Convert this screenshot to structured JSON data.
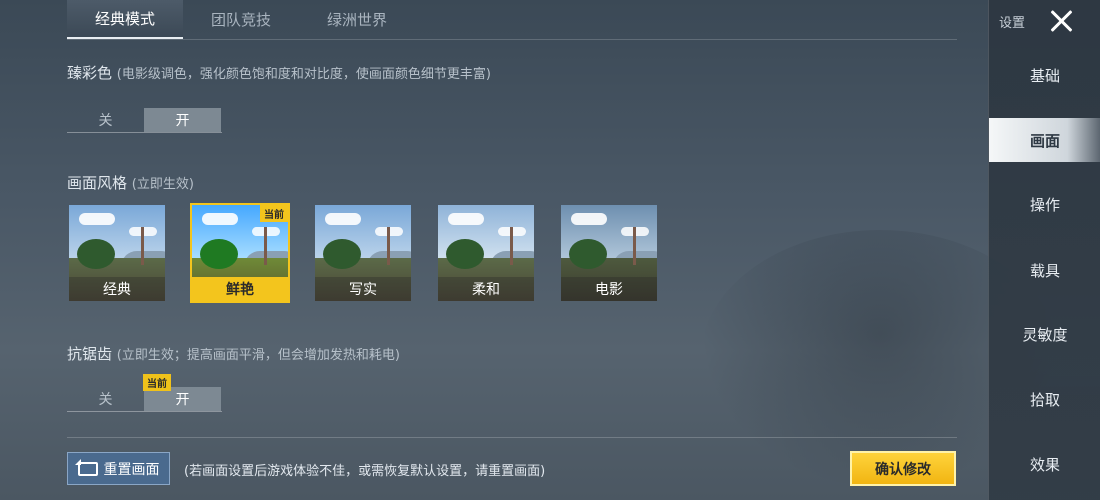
{
  "tabs": [
    "经典模式",
    "团队竞技",
    "绿洲世界"
  ],
  "color_section": {
    "title": "臻彩色",
    "note": "(电影级调色，强化颜色饱和度和对比度，使画面颜色细节更丰富)",
    "off": "关",
    "on": "开"
  },
  "style_section": {
    "title": "画面风格",
    "note": "(立即生效)",
    "current_badge": "当前",
    "options": [
      "经典",
      "鲜艳",
      "写实",
      "柔和",
      "电影"
    ]
  },
  "aa_section": {
    "title": "抗锯齿",
    "note": "(立即生效；提高画面平滑，但会增加发热和耗电)",
    "off": "关",
    "on": "开",
    "current_badge": "当前"
  },
  "footer": {
    "reset_label": "重置画面",
    "reset_note": "(若画面设置后游戏体验不佳，或需恢复默认设置，请重置画面)",
    "confirm_label": "确认修改"
  },
  "sidebar": {
    "header": "设置",
    "items": [
      "基础",
      "画面",
      "操作",
      "载具",
      "灵敏度",
      "拾取",
      "效果"
    ]
  },
  "colors": {
    "accent_yellow": "#f3c51d",
    "toggle_on": "#7d8993",
    "reset_blue": "#4a6a8e"
  }
}
